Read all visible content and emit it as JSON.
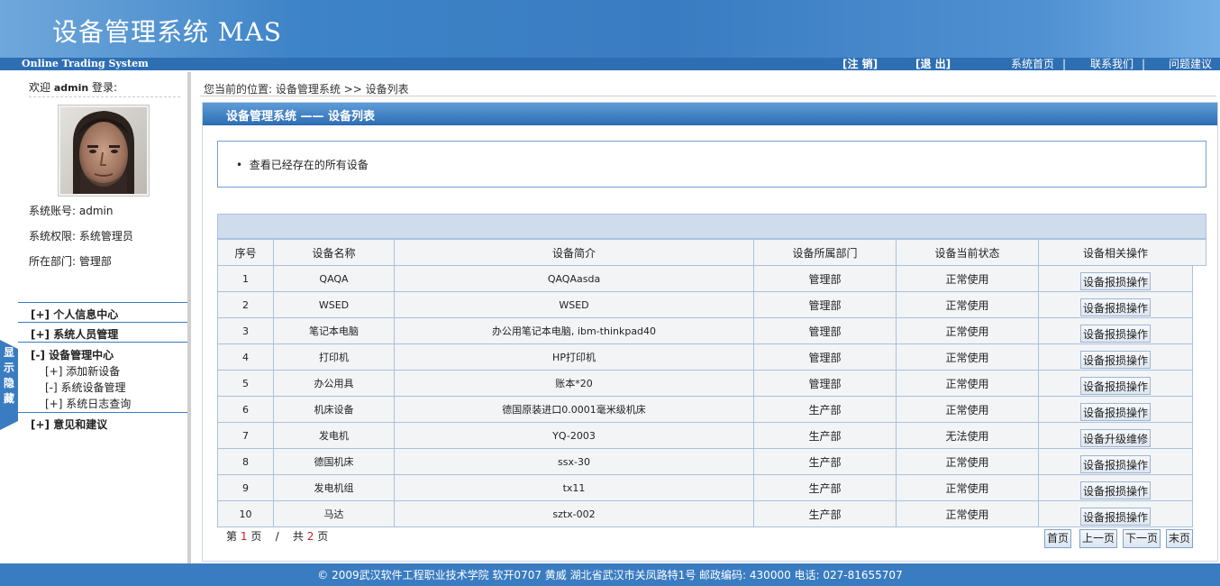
{
  "header": {
    "title": "设备管理系统  MAS",
    "subtitle": "Online Trading System",
    "logout": "[注 销]",
    "exit": "[退 出]",
    "links": [
      "系统首页",
      "联系我们",
      "问题建议"
    ],
    "separator": "|"
  },
  "sidebar": {
    "welcome_prefix": "欢迎",
    "username": "admin",
    "welcome_suffix": "登录:",
    "account": "系统账号: admin",
    "permission": "系统权限: 系统管理员",
    "department": "所在部门: 管理部",
    "menu": [
      {
        "label": "[+] 个人信息中心"
      },
      {
        "label": "[+] 系统人员管理"
      },
      {
        "label": "[-] 设备管理中心",
        "children": [
          "[+] 添加新设备",
          "[-] 系统设备管理",
          "[+] 系统日志查询"
        ]
      },
      {
        "label": "[+] 意见和建议"
      }
    ],
    "toggle": [
      "显",
      "示",
      "隐",
      "藏"
    ]
  },
  "main": {
    "breadcrumb": "您当前的位置: 设备管理系统 >> 设备列表",
    "panel_title": "设备管理系统 —— 设备列表",
    "description": "查看已经存在的所有设备",
    "table": {
      "columns": [
        "序号",
        "设备名称",
        "设备简介",
        "设备所属部门",
        "设备当前状态",
        "设备相关操作"
      ],
      "rows": [
        [
          "1",
          "QAQA",
          "QAQAasda",
          "管理部",
          "正常使用",
          "设备报损操作"
        ],
        [
          "2",
          "WSED",
          "WSED",
          "管理部",
          "正常使用",
          "设备报损操作"
        ],
        [
          "3",
          "笔记本电脑",
          "办公用笔记本电脑, ibm-thinkpad40",
          "管理部",
          "正常使用",
          "设备报损操作"
        ],
        [
          "4",
          "打印机",
          "HP打印机",
          "管理部",
          "正常使用",
          "设备报损操作"
        ],
        [
          "5",
          "办公用具",
          "账本*20",
          "管理部",
          "正常使用",
          "设备报损操作"
        ],
        [
          "6",
          "机床设备",
          "德国原装进口0.0001毫米级机床",
          "生产部",
          "正常使用",
          "设备报损操作"
        ],
        [
          "7",
          "发电机",
          "YQ-2003",
          "生产部",
          "无法使用",
          "设备升级维修"
        ],
        [
          "8",
          "德国机床",
          "ssx-30",
          "生产部",
          "正常使用",
          "设备报损操作"
        ],
        [
          "9",
          "发电机组",
          "tx11",
          "生产部",
          "正常使用",
          "设备报损操作"
        ],
        [
          "10",
          "马达",
          "sztx-002",
          "生产部",
          "正常使用",
          "设备报损操作"
        ]
      ]
    },
    "pager": {
      "page_prefix": "第",
      "current_page": "1",
      "page_unit": "页",
      "divider": "/",
      "total_prefix": "共",
      "total_pages": "2",
      "total_unit": "页",
      "buttons": [
        "首页",
        "上一页",
        "下一页",
        "末页"
      ]
    }
  },
  "footer": {
    "text": "© 2009武汉软件工程职业技术学院 软开0707 黄威 湖北省武汉市关凤路特1号 邮政编码: 430000 电话: 027-81655707"
  }
}
